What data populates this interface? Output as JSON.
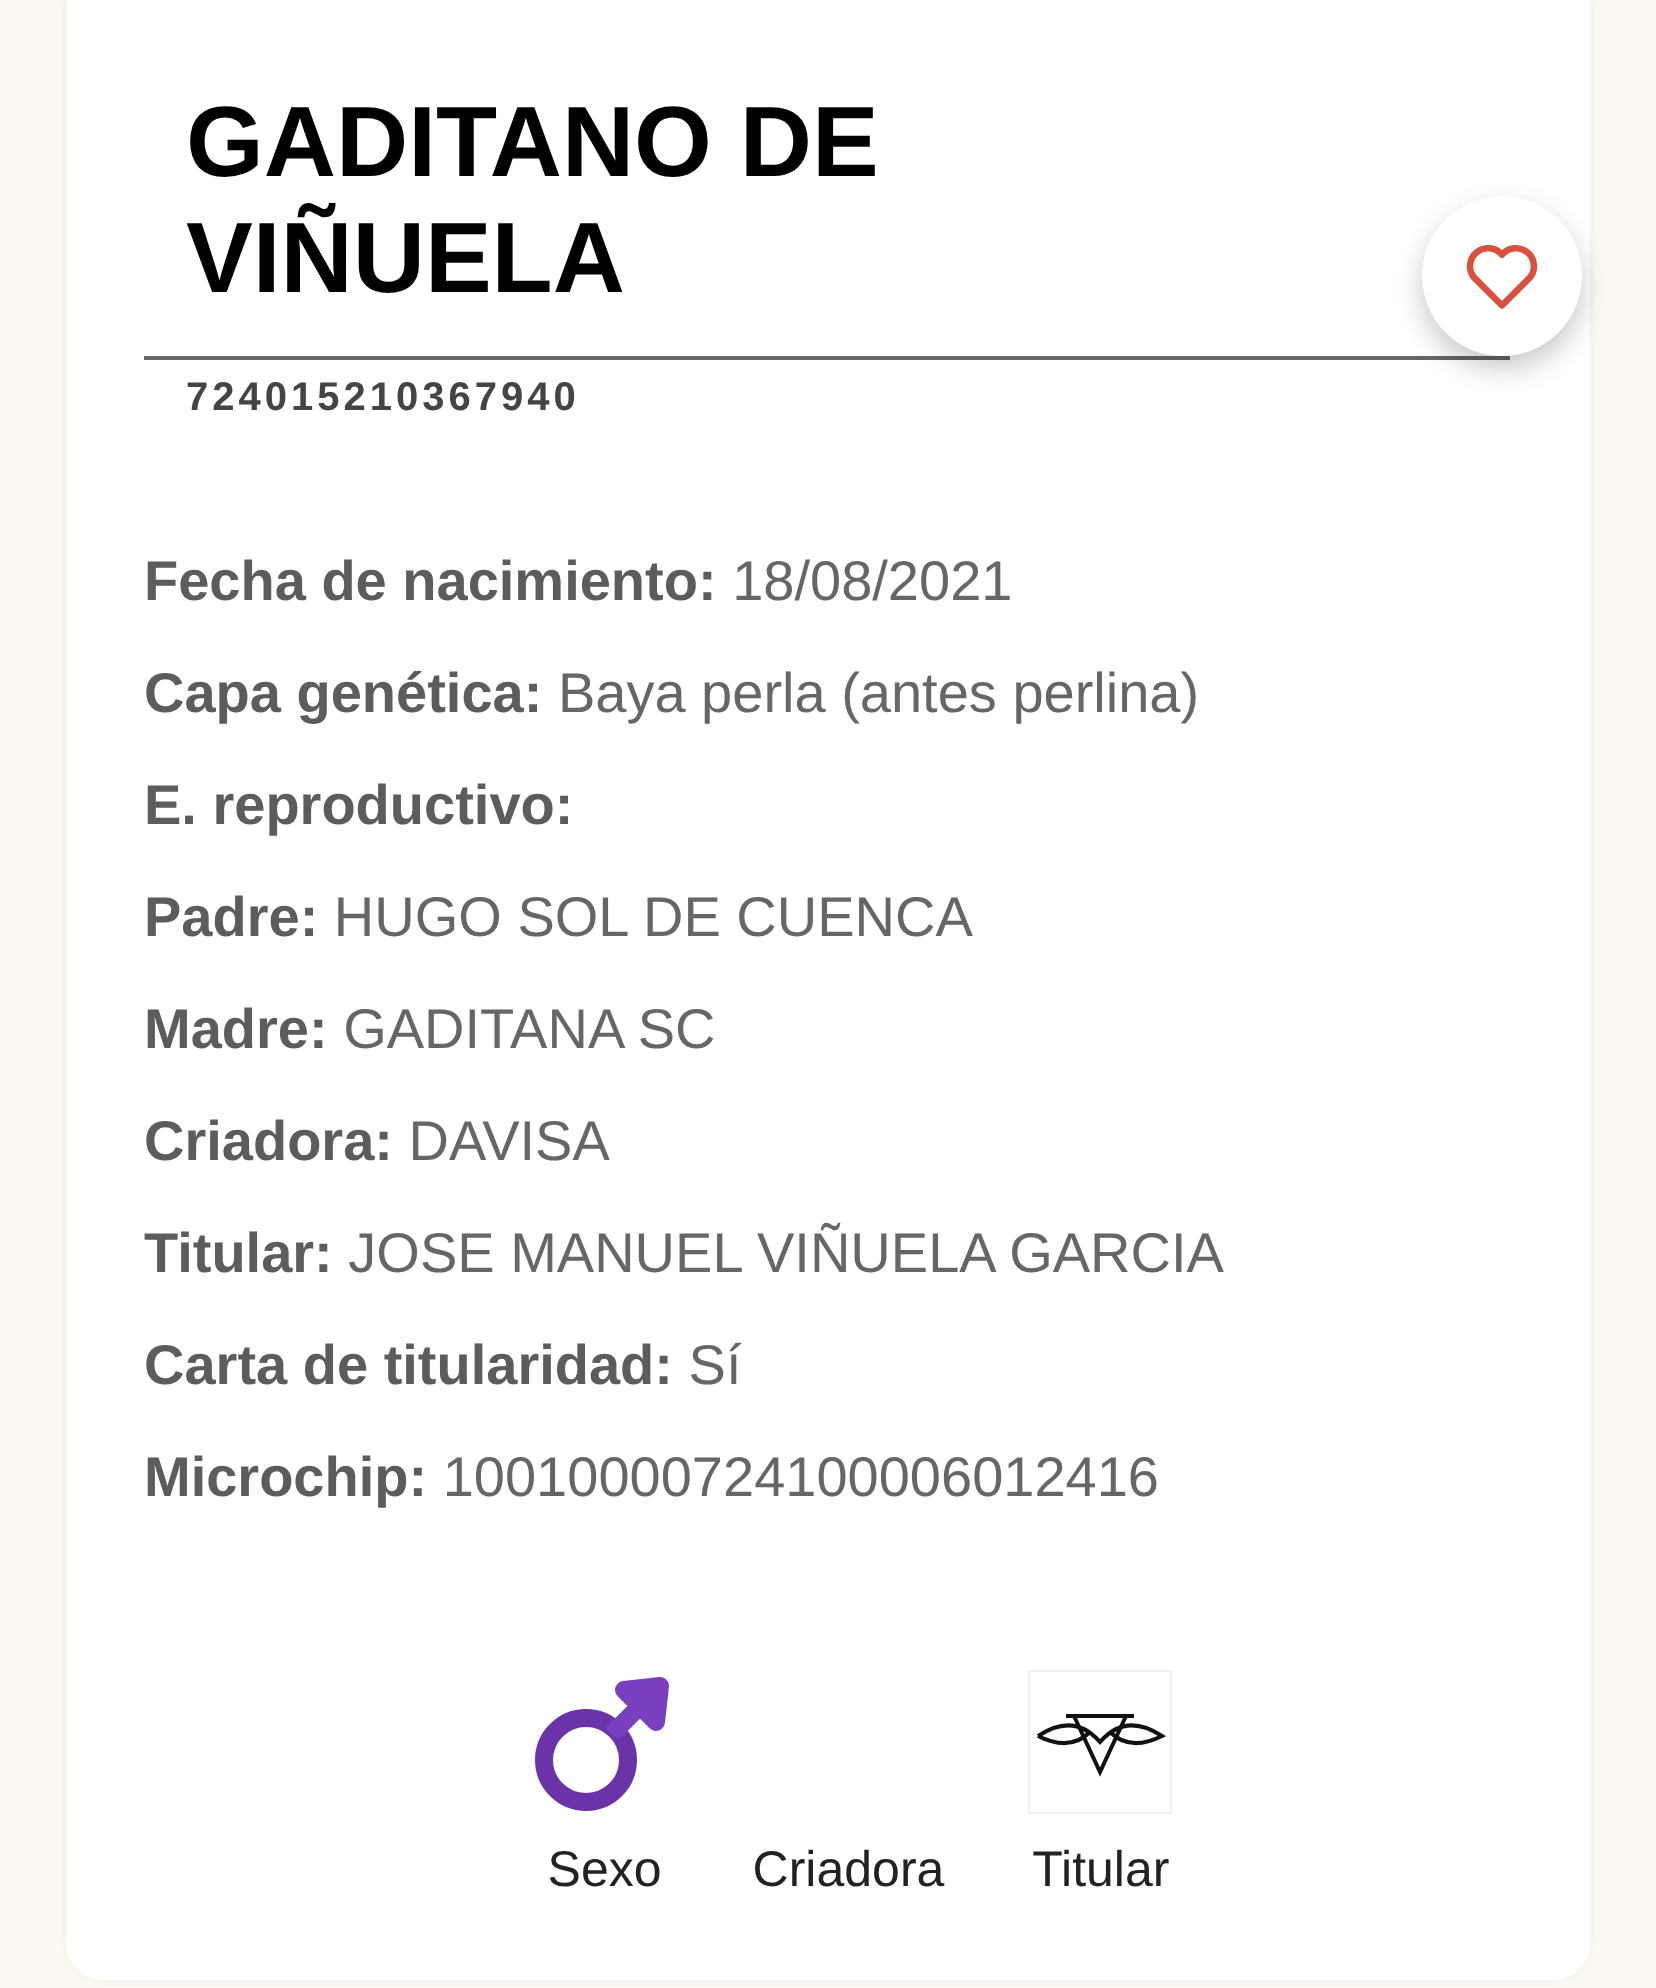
{
  "title": "GADITANO DE VIÑUELA",
  "favorite": {
    "selected": false
  },
  "id_number": "724015210367940",
  "fields": [
    {
      "label": "Fecha de nacimiento:",
      "value": "18/08/2021"
    },
    {
      "label": "Capa genética:",
      "value": "Baya perla (antes perlina)"
    },
    {
      "label": "E. reproductivo:"
    },
    {
      "label": "Padre:",
      "value": "HUGO SOL DE CUENCA"
    },
    {
      "label": "Madre:",
      "value": "GADITANA SC"
    },
    {
      "label": "Criadora:",
      "value": "DAVISA"
    },
    {
      "label": "Titular:",
      "value": "JOSE MANUEL VIÑUELA GARCIA"
    },
    {
      "label": "Carta de titularidad:",
      "value": "Sí"
    },
    {
      "label": "Microchip:",
      "value": "10010000724100006012416"
    }
  ],
  "actions": [
    {
      "label": "Sexo",
      "kind": "male"
    },
    {
      "label": "Criadora",
      "kind": "blank"
    },
    {
      "label": "Titular",
      "kind": "logo"
    }
  ]
}
